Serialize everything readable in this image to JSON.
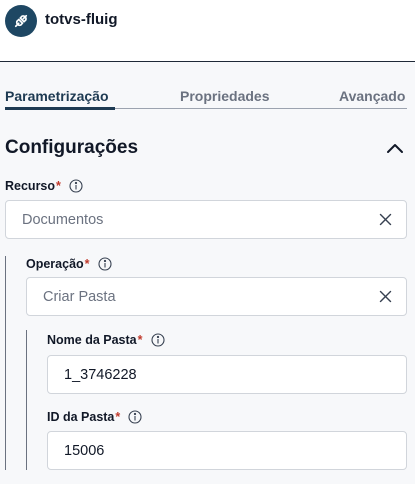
{
  "header": {
    "title": "totvs-fluig",
    "icon": "plug-icon"
  },
  "tabs": [
    {
      "label": "Parametrização",
      "active": true
    },
    {
      "label": "Propriedades",
      "active": false
    },
    {
      "label": "Avançado",
      "active": false
    }
  ],
  "section": {
    "title": "Configurações"
  },
  "fields": {
    "recurso": {
      "label": "Recurso",
      "required": "*",
      "value": "Documentos"
    },
    "operacao": {
      "label": "Operação",
      "required": "*",
      "value": "Criar Pasta"
    },
    "nome_pasta": {
      "label": "Nome da Pasta",
      "required": "*",
      "value": "1_3746228"
    },
    "id_pasta": {
      "label": "ID da Pasta",
      "required": "*",
      "value": "15006"
    }
  },
  "colors": {
    "accent": "#1e3a52",
    "icon_bg": "#1e4763",
    "required": "#c0392b"
  }
}
